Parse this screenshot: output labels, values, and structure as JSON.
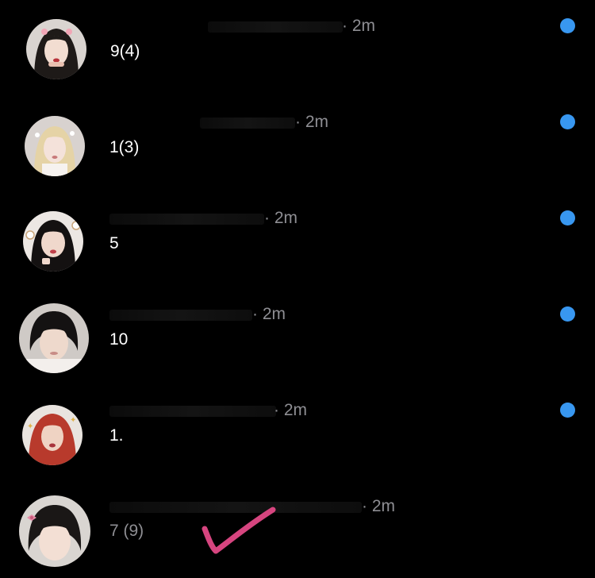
{
  "colors": {
    "background": "#000000",
    "unread_dot": "#3897f0",
    "timestamp": "#8e8e93",
    "preview_text": "#ffffff",
    "check_mark": "#d6457f"
  },
  "conversations": [
    {
      "time": "· 2m",
      "preview": "9(4)",
      "unread": true
    },
    {
      "time": "· 2m",
      "preview": "1(3)",
      "unread": true
    },
    {
      "time": "· 2m",
      "preview": "5",
      "unread": true
    },
    {
      "time": "· 2m",
      "preview": "10",
      "unread": true
    },
    {
      "time": "· 2m",
      "preview": "1.",
      "unread": true
    },
    {
      "time": "· 2m",
      "preview": "7 (9)",
      "unread": false
    }
  ],
  "annotation": {
    "icon": "check-mark-icon"
  }
}
